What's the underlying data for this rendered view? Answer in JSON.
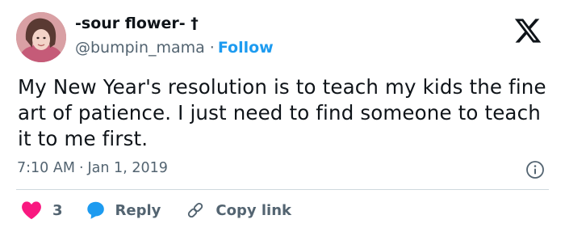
{
  "author": {
    "display_name": "-sour flower- †",
    "handle": "@bumpin_mama",
    "separator": "·",
    "follow_label": "Follow"
  },
  "tweet": {
    "text": "My New Year's resolution is to teach my kids the fine art of patience. I just need to find someone to teach it to me first."
  },
  "meta": {
    "time": "7:10 AM",
    "separator": "·",
    "date": "Jan 1, 2019"
  },
  "actions": {
    "like_count": "3",
    "reply_label": "Reply",
    "copy_link_label": "Copy link"
  },
  "icons": {
    "logo": "x-logo-icon",
    "info": "info-icon",
    "like": "heart-icon",
    "reply": "speech-bubble-icon",
    "copy": "link-icon"
  },
  "colors": {
    "accent": "#1d9bf0",
    "like": "#f91880",
    "text": "#0f1419",
    "secondary": "#536471",
    "divider": "#cfd9de"
  }
}
